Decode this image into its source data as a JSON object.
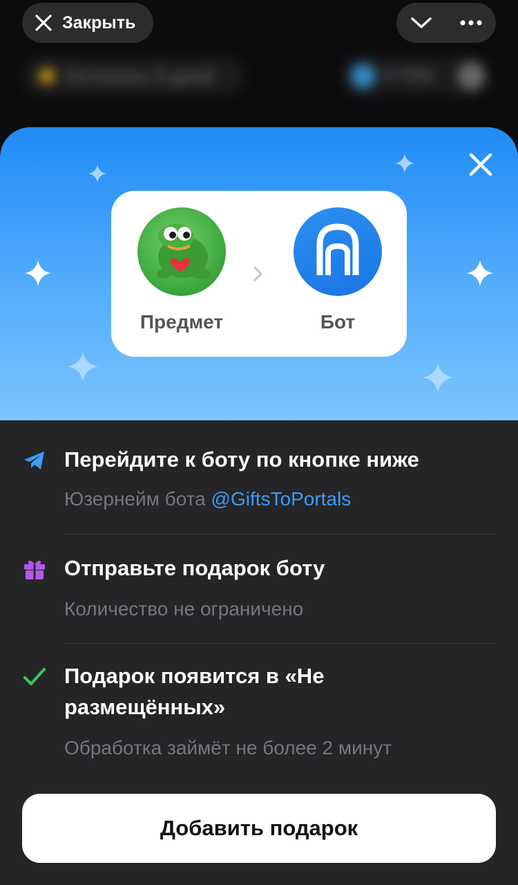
{
  "topbar": {
    "close_label": "Закрыть",
    "close_icon": "close-icon",
    "collapse_icon": "chevron-down-icon",
    "more_icon": "more-dots-icon"
  },
  "background": {
    "left_text": "Осталось 5 дней",
    "right_text": "0 TON"
  },
  "sheet": {
    "close_icon": "close-icon",
    "flow": {
      "item_label": "Предмет",
      "bot_label": "Бот",
      "arrow_icon": "chevron-right-icon"
    },
    "steps": [
      {
        "icon": "telegram-plane-icon",
        "title": "Перейдите к боту по кнопке ниже",
        "sub_prefix": "Юзернейм бота ",
        "sub_link": "@GiftsToPortals"
      },
      {
        "icon": "gift-icon",
        "title": "Отправьте подарок боту",
        "sub": "Количество не ограничено"
      },
      {
        "icon": "check-icon",
        "title": "Подарок появится в «Не размещённых»",
        "sub": "Обработка займёт не более 2 минут"
      }
    ],
    "primary_button": "Добавить подарок"
  },
  "colors": {
    "accent_blue": "#3d9bf5",
    "gift_purple": "#b15ae8",
    "check_green": "#34c759",
    "sheet_bg": "#252527"
  }
}
